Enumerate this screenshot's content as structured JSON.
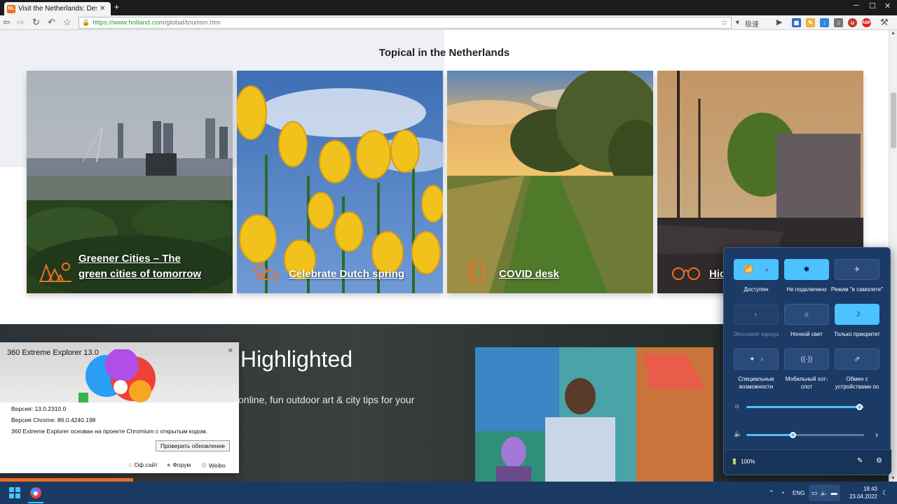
{
  "browser": {
    "tab_title": "Visit the Netherlands: Destina",
    "favicon_text": "NL",
    "url_host": "https://www.holland.com",
    "url_path": "/global/tourism.htm",
    "tb_label": "极速"
  },
  "page": {
    "section_title": "Topical in the Netherlands",
    "cards": [
      {
        "title": "Greener Cities – The green cities of tomorrow",
        "icon": "city-skyline-icon"
      },
      {
        "title": "Celebrate Dutch spring",
        "icon": "sun-cloud-icon"
      },
      {
        "title": "COVID desk",
        "icon": "book-icon"
      },
      {
        "title": "Hid... Ne...",
        "icon": "binoculars-icon"
      }
    ],
    "highlight_title": "Highlighted",
    "highlight_sub": "online, fun outdoor art & city tips for your"
  },
  "about": {
    "title": "360 Extreme Explorer 13.0",
    "version": "Версия: 13.0.2310.0",
    "chrome_version": "Версия Chrome: 86.0.4240.198",
    "based_on": "360 Extreme Explorer основан на проекте Chromium с открытым кодом.",
    "update_button": "Проверить обновление",
    "links": [
      "Оф.сайт",
      "Форум",
      "Weibo"
    ]
  },
  "quick_settings": {
    "tiles": [
      {
        "label": "Доступен",
        "icon": "wifi-icon",
        "state": "on"
      },
      {
        "label": "Не подключено",
        "icon": "bluetooth-icon",
        "state": "on"
      },
      {
        "label": "Режим \"в самолете\"",
        "icon": "airplane-icon",
        "state": "off"
      },
      {
        "label": "Экономия заряда",
        "icon": "battery-saver-icon",
        "state": "dis"
      },
      {
        "label": "Ночной свет",
        "icon": "night-light-icon",
        "state": "off"
      },
      {
        "label": "Только приоритет",
        "icon": "moon-icon",
        "state": "on"
      },
      {
        "label": "Специальные возможности",
        "icon": "accessibility-icon",
        "state": "off"
      },
      {
        "label": "Мобильный хот-спот",
        "icon": "hotspot-icon",
        "state": "off"
      },
      {
        "label": "Обмен с устройствами по",
        "icon": "share-icon",
        "state": "off"
      }
    ],
    "brightness": 0.96,
    "volume": 0.39,
    "battery": "100%"
  },
  "taskbar": {
    "lang": "ENG",
    "time": "18:43",
    "date": "23.04.2022"
  },
  "colors": {
    "accent_orange": "#f37021",
    "qs_accent": "#4cc2ff",
    "taskbar": "#1a3a64"
  }
}
